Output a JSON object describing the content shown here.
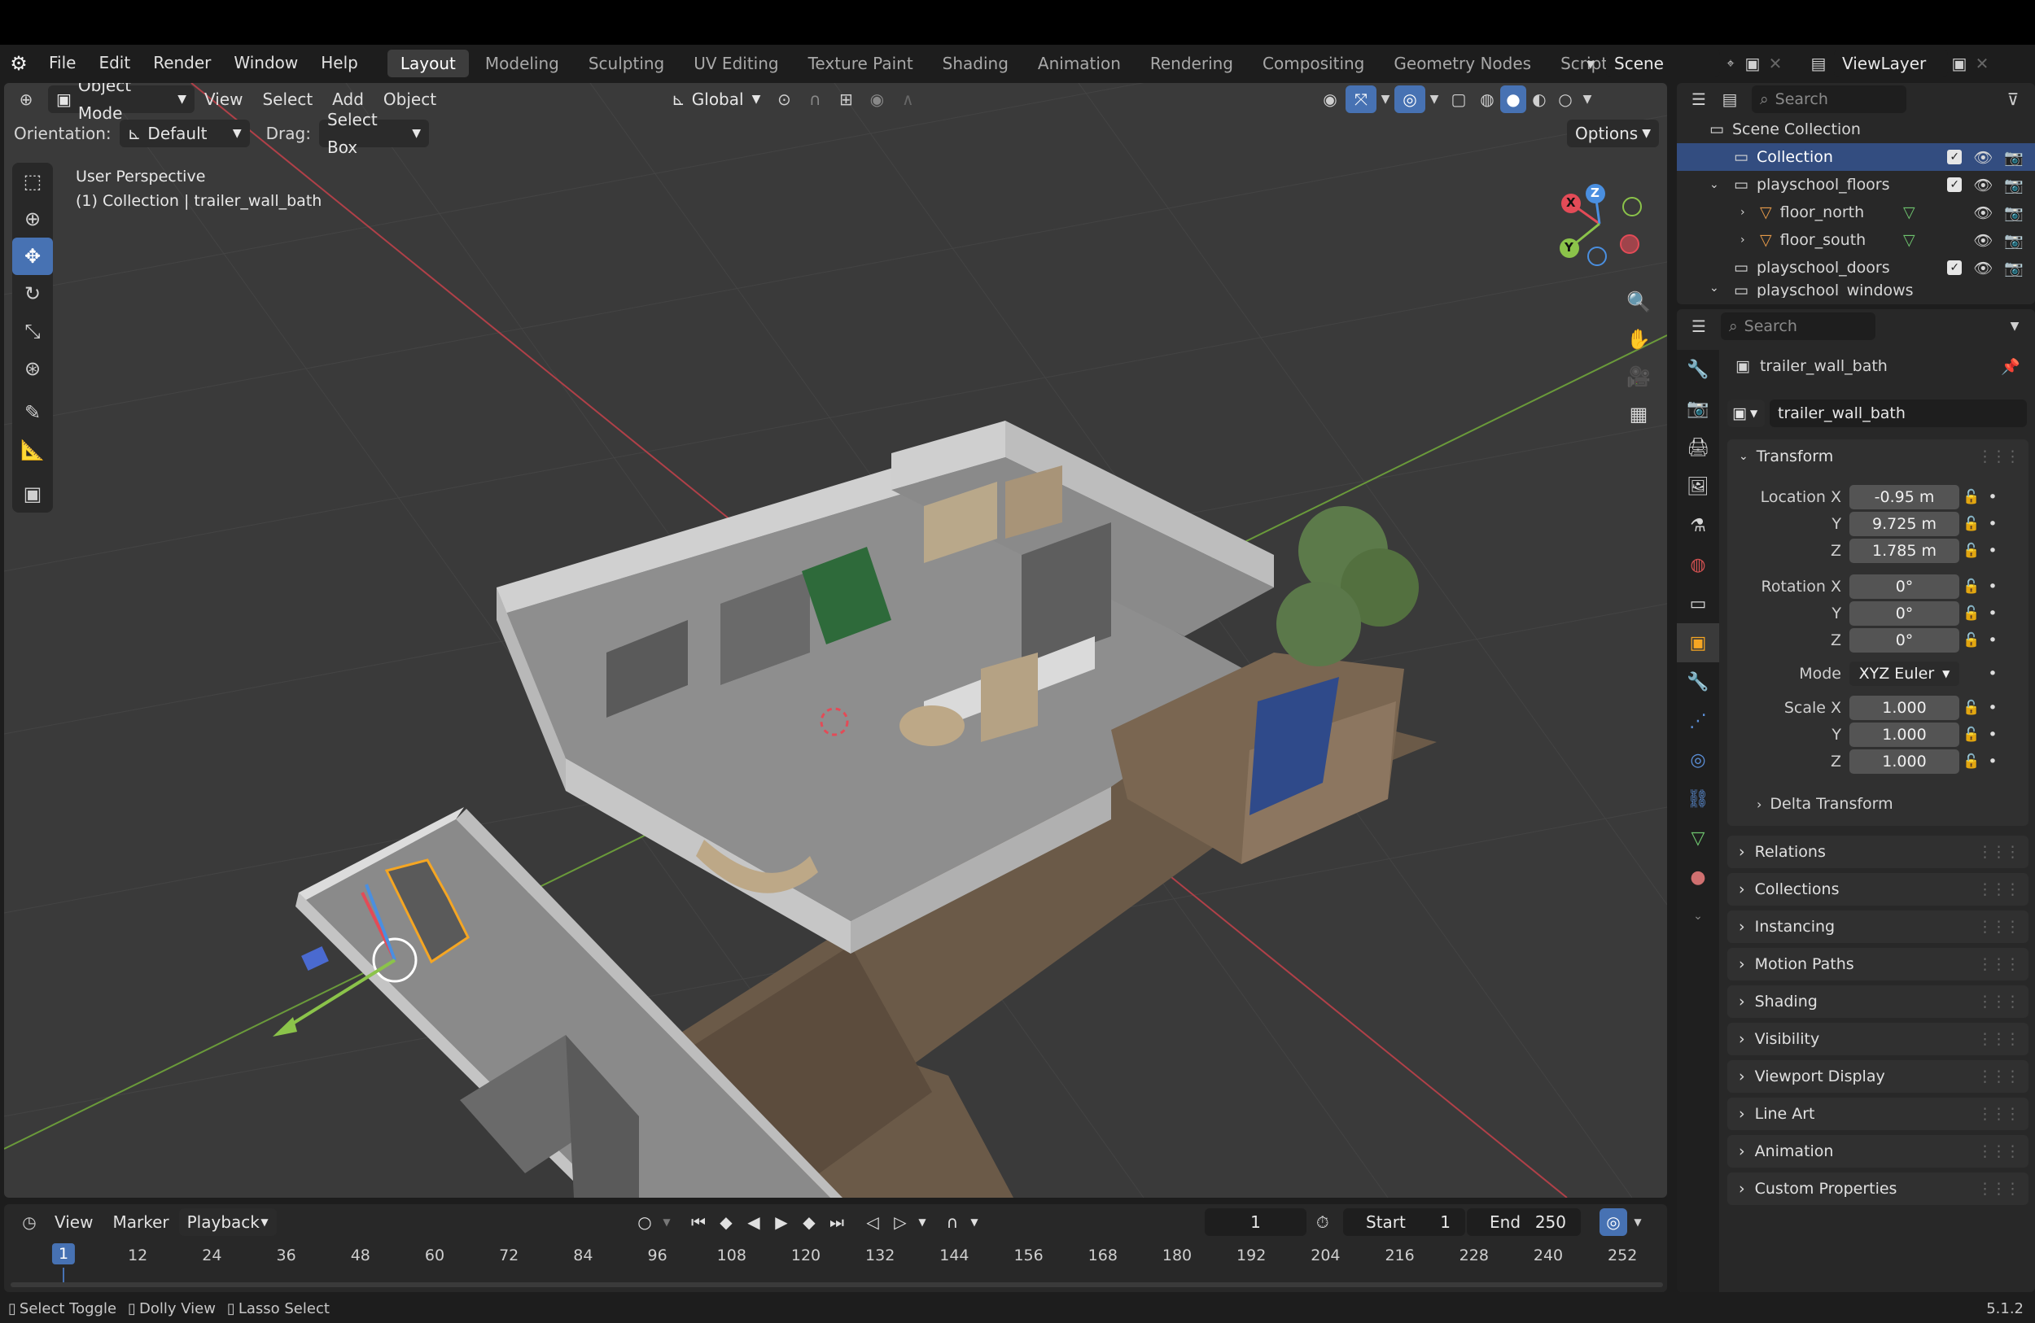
{
  "topbar": {
    "menus": [
      "File",
      "Edit",
      "Render",
      "Window",
      "Help"
    ],
    "workspaces": [
      "Layout",
      "Modeling",
      "Sculpting",
      "UV Editing",
      "Texture Paint",
      "Shading",
      "Animation",
      "Rendering",
      "Compositing",
      "Geometry Nodes",
      "Scripting"
    ],
    "active_workspace": "Layout",
    "scene": "Scene",
    "view_layer": "ViewLayer"
  },
  "viewport": {
    "mode": "Object Mode",
    "menus": [
      "View",
      "Select",
      "Add",
      "Object"
    ],
    "transform_orientation": "Global",
    "orientation_label": "Orientation:",
    "orientation_value": "Default",
    "drag_label": "Drag:",
    "drag_value": "Select Box",
    "options_label": "Options",
    "info_line1": "User Perspective",
    "info_line2": "(1) Collection | trailer_wall_bath",
    "gizmo_axes": {
      "x": "X",
      "y": "Y",
      "z": "Z"
    },
    "colors": {
      "x_axis": "#e34b57",
      "y_axis": "#8bc34a",
      "z_axis": "#4a8fe0",
      "selection": "#f5a623"
    }
  },
  "outliner": {
    "search_placeholder": "Search",
    "root": "Scene Collection",
    "items": [
      {
        "name": "Collection",
        "selected": true
      },
      {
        "name": "playschool_floors"
      },
      {
        "name": "floor_north"
      },
      {
        "name": "floor_south"
      },
      {
        "name": "playschool_doors"
      },
      {
        "name": "playschool_windows"
      }
    ]
  },
  "properties": {
    "search_placeholder": "Search",
    "object_name": "trailer_wall_bath",
    "datablock_name": "trailer_wall_bath",
    "transform_title": "Transform",
    "location_label": "Location X",
    "location": {
      "x": "-0.95 m",
      "y": "9.725 m",
      "z": "1.785 m"
    },
    "rotation_label": "Rotation X",
    "rotation": {
      "x": "0°",
      "y": "0°",
      "z": "0°"
    },
    "mode_label": "Mode",
    "mode_value": "XYZ Euler",
    "scale_label": "Scale X",
    "scale": {
      "x": "1.000",
      "y": "1.000",
      "z": "1.000"
    },
    "axis_y": "Y",
    "axis_z": "Z",
    "delta_transform": "Delta Transform",
    "panels": [
      "Relations",
      "Collections",
      "Instancing",
      "Motion Paths",
      "Shading",
      "Visibility",
      "Viewport Display",
      "Line Art",
      "Animation",
      "Custom Properties"
    ]
  },
  "timeline": {
    "menus": [
      "View",
      "Marker",
      "Playback"
    ],
    "current_frame": "1",
    "start_label": "Start",
    "start": "1",
    "end_label": "End",
    "end": "250",
    "ticks": [
      "1",
      "12",
      "24",
      "36",
      "48",
      "60",
      "72",
      "84",
      "96",
      "108",
      "120",
      "132",
      "144",
      "156",
      "168",
      "180",
      "192",
      "204",
      "216",
      "228",
      "240",
      "252"
    ]
  },
  "statusbar": {
    "hints": [
      "Select Toggle",
      "Dolly View",
      "Lasso Select"
    ],
    "version": "5.1.2"
  }
}
